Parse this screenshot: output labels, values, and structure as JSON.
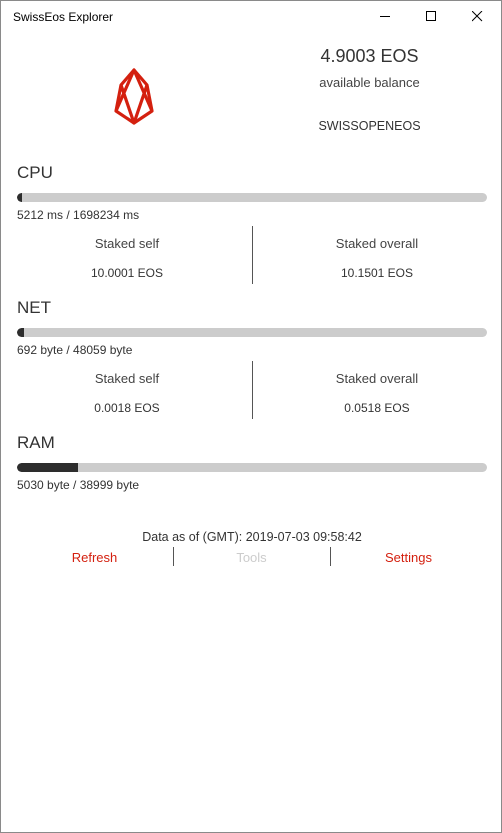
{
  "window": {
    "title": "SwissEos Explorer"
  },
  "account": {
    "balance": "4.9003 EOS",
    "balance_label": "available balance",
    "name": "SWISSOPENEOS"
  },
  "cpu": {
    "title": "CPU",
    "usage_text": "5212 ms / 1698234 ms",
    "usage_fraction": 0.0031,
    "staked_self_label": "Staked self",
    "staked_self_value": "10.0001 EOS",
    "staked_overall_label": "Staked overall",
    "staked_overall_value": "10.1501 EOS"
  },
  "net": {
    "title": "NET",
    "usage_text": "692 byte / 48059 byte",
    "usage_fraction": 0.0144,
    "staked_self_label": "Staked self",
    "staked_self_value": "0.0018 EOS",
    "staked_overall_label": "Staked overall",
    "staked_overall_value": "0.0518 EOS"
  },
  "ram": {
    "title": "RAM",
    "usage_text": "5030 byte / 38999 byte",
    "usage_fraction": 0.129
  },
  "footer": {
    "as_of": "Data as of (GMT): 2019-07-03 09:58:42",
    "refresh": "Refresh",
    "tools": "Tools",
    "settings": "Settings"
  },
  "colors": {
    "accent": "#d4200f",
    "bar_track": "#cccccc",
    "bar_fill": "#2d2d2d",
    "disabled": "#cccccc"
  },
  "icons": {
    "logo": "eos-logo-icon",
    "minimize": "minimize-icon",
    "maximize": "maximize-icon",
    "close": "close-icon"
  }
}
